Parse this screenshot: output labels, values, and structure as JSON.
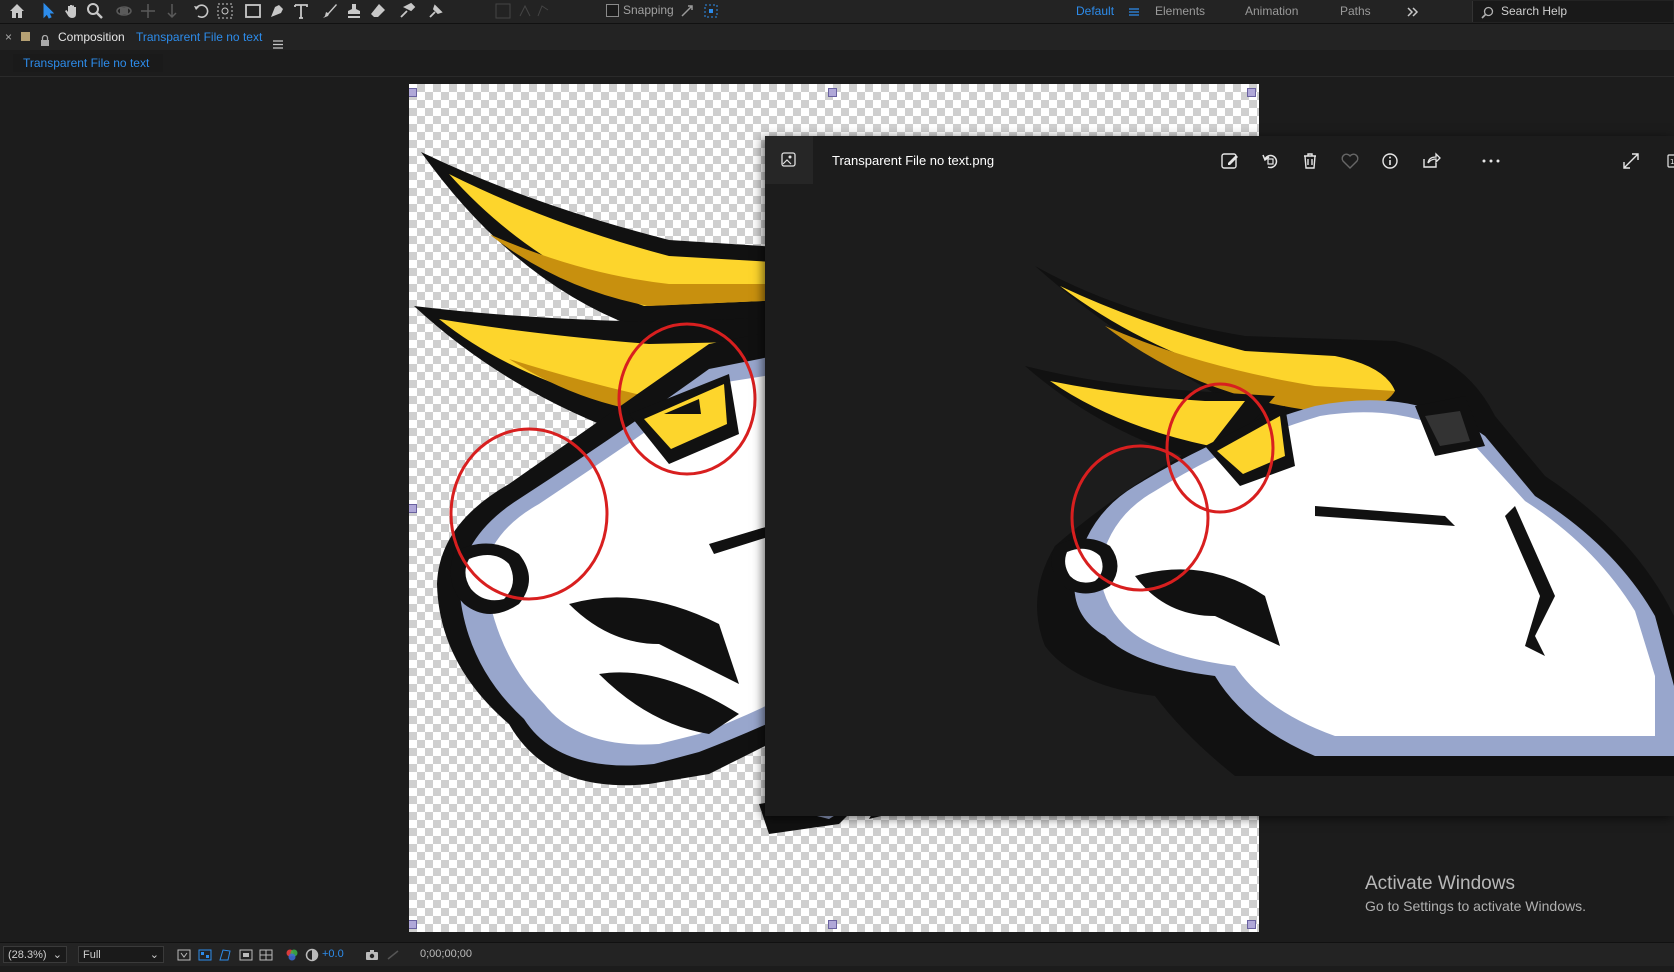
{
  "toolbar": {
    "tools": [
      "home-icon",
      "selection-tool-icon",
      "hand-tool-icon",
      "zoom-tool-icon",
      "orbit-camera-icon",
      "pan-camera-icon",
      "dolly-camera-icon",
      "rotate-tool-icon",
      "pan-behind-icon",
      "rectangle-tool-icon",
      "pen-tool-icon",
      "type-tool-icon",
      "brush-tool-icon",
      "clone-stamp-icon",
      "eraser-tool-icon",
      "roto-brush-icon",
      "puppet-pin-icon"
    ],
    "snapping_label": "Snapping",
    "workspaces": [
      "Default",
      "Elements",
      "Animation",
      "Paths"
    ],
    "active_workspace": "Default",
    "search_placeholder": "Search Help"
  },
  "panel": {
    "prefix": "Composition",
    "comp_name": "Transparent File no text",
    "tab_label": "Transparent File no text"
  },
  "viewer": {
    "filename": "Transparent File no text.png",
    "icons": [
      "edit-image-icon",
      "rotate-icon",
      "delete-icon",
      "favorite-icon",
      "info-icon",
      "share-icon",
      "more-icon",
      "fullscreen-icon",
      "actual-size-icon"
    ]
  },
  "watermark": {
    "title": "Activate Windows",
    "subtitle": "Go to Settings to activate Windows."
  },
  "statusbar": {
    "zoom": "(28.3%)",
    "resolution": "Full",
    "exposure": "+0.0",
    "timecode": "0;00;00;00"
  },
  "colors": {
    "accent": "#2d8ceb",
    "yellow": "#fdd52c",
    "gold": "#c8900e",
    "blue_gray": "#98a6cc",
    "annotation_red": "#d81f1f"
  }
}
